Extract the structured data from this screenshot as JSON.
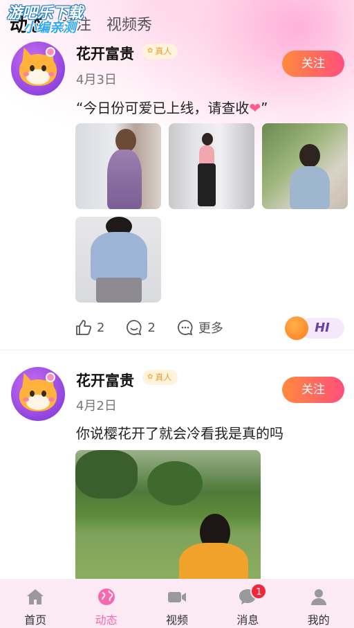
{
  "watermark": {
    "line1": "游吧乐下载",
    "line2": "小编亲测"
  },
  "top_tabs": [
    {
      "label": "动态",
      "active": true
    },
    {
      "label": "关注",
      "active": false
    },
    {
      "label": "视频秀",
      "active": false
    }
  ],
  "posts": [
    {
      "author": "花开富贵",
      "badge": "真人",
      "date": "4月3日",
      "text": "“今日份可爱已上线，请查收",
      "text_emoji": "❤",
      "text_end": "”",
      "follow_label": "关注",
      "likes": "2",
      "comments": "2",
      "more_label": "更多",
      "hi_label": "HI"
    },
    {
      "author": "花开富贵",
      "badge": "真人",
      "date": "4月2日",
      "text": "你说樱花开了就会冷看我是真的吗",
      "follow_label": "关注"
    }
  ],
  "bottom_nav": [
    {
      "label": "首页",
      "icon": "home-icon",
      "active": false
    },
    {
      "label": "动态",
      "icon": "globe-icon",
      "active": true
    },
    {
      "label": "视频",
      "icon": "video-camera-icon",
      "active": false
    },
    {
      "label": "消息",
      "icon": "chat-bubble-icon",
      "active": false,
      "badge": "1"
    },
    {
      "label": "我的",
      "icon": "user-icon",
      "active": false
    }
  ],
  "colors": {
    "accent_pink": "#f46ab0",
    "follow_gradient_start": "#ff8a3d",
    "follow_gradient_end": "#ff4f7a",
    "badge_red": "#f0273b"
  }
}
